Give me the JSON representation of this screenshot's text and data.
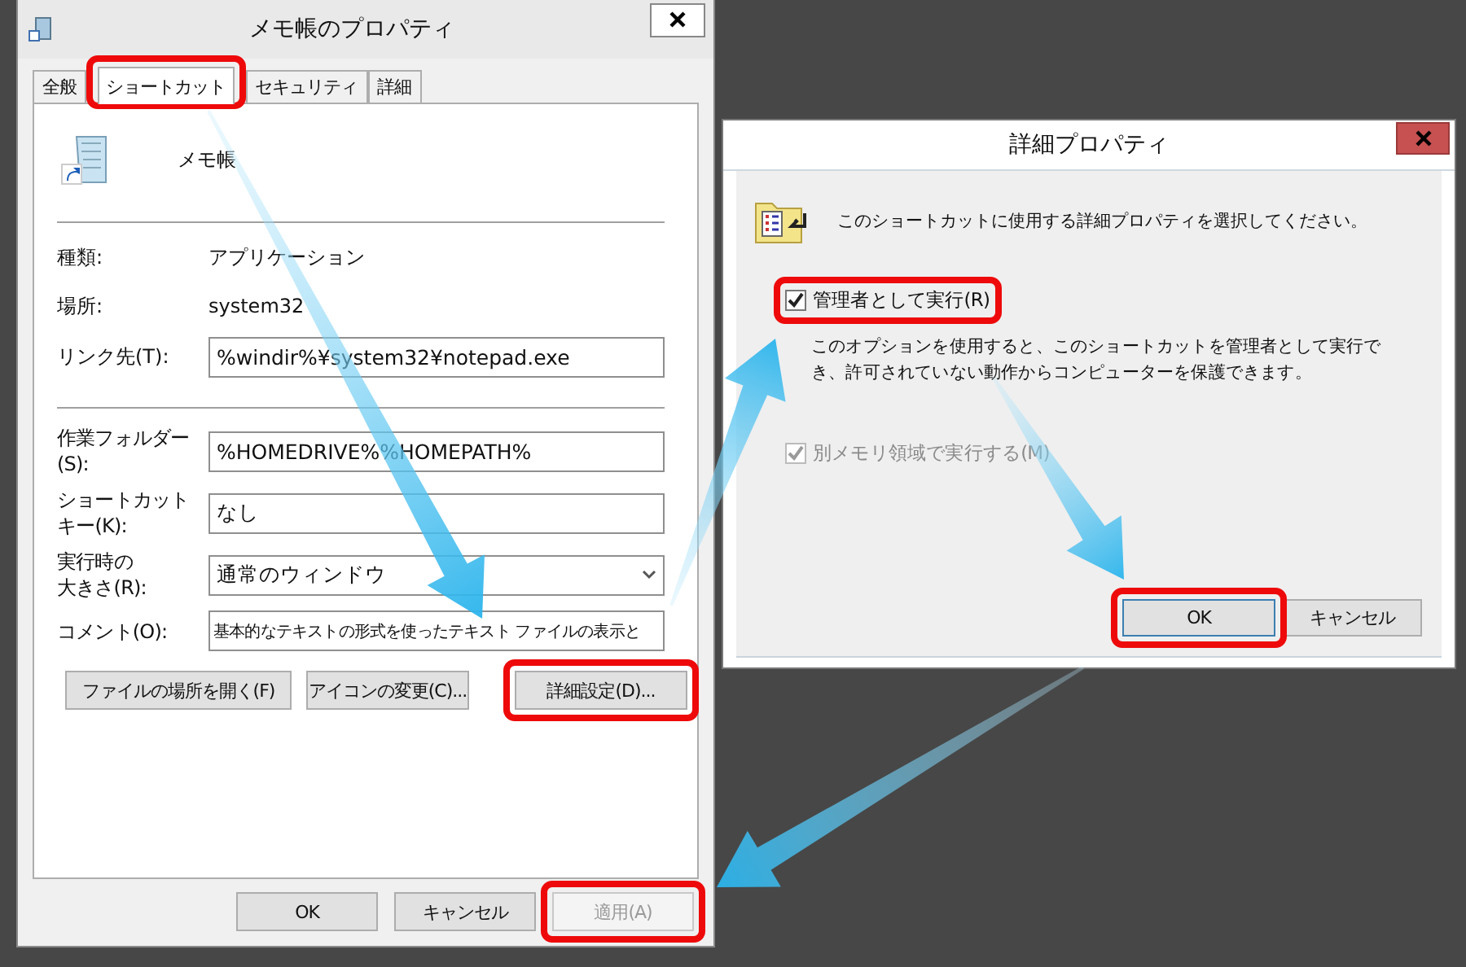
{
  "properties_dialog": {
    "title": "メモ帳のプロパティ",
    "tabs": [
      {
        "label": "全般",
        "selected": false,
        "highlighted": false
      },
      {
        "label": "ショートカット",
        "selected": true,
        "highlighted": true
      },
      {
        "label": "セキュリティ",
        "selected": false,
        "highlighted": false
      },
      {
        "label": "詳細",
        "selected": false,
        "highlighted": false
      }
    ],
    "app_name": "メモ帳",
    "info": [
      {
        "label": "種類:",
        "value": "アプリケーション"
      },
      {
        "label": "場所:",
        "value": "system32"
      }
    ],
    "target": {
      "label": "リンク先(T):",
      "value": "%windir%¥system32¥notepad.exe"
    },
    "fields": [
      {
        "kind": "text",
        "label_lines": [
          "作業フォルダー",
          "(S):"
        ],
        "value": "%HOMEDRIVE%%HOMEPATH%"
      },
      {
        "kind": "text",
        "label_lines": [
          "ショートカット",
          "キー(K):"
        ],
        "value": "なし"
      },
      {
        "kind": "select",
        "label_lines": [
          "実行時の",
          "大きさ(R):"
        ],
        "value": "通常のウィンドウ"
      },
      {
        "kind": "comment",
        "label_lines": [
          "コメント(O):"
        ],
        "value": "基本的なテキストの形式を使ったテキスト ファイルの表示と"
      }
    ],
    "buttons": [
      {
        "label": "ファイルの場所を開く(F)",
        "highlighted": false
      },
      {
        "label": "アイコンの変更(C)...",
        "highlighted": false
      },
      {
        "label": "詳細設定(D)...",
        "highlighted": true
      }
    ],
    "footer_buttons": [
      {
        "label": "OK",
        "disabled": false,
        "highlighted": false
      },
      {
        "label": "キャンセル",
        "disabled": false,
        "highlighted": false
      },
      {
        "label": "適用(A)",
        "disabled": true,
        "highlighted": true
      }
    ]
  },
  "advanced_dialog": {
    "title": "詳細プロパティ",
    "prompt": "このショートカットに使用する詳細プロパティを選択してください。",
    "options": [
      {
        "label": "管理者として実行(R)",
        "checked": true,
        "disabled": false,
        "highlighted": true,
        "description": "このオプションを使用すると、このショートカットを管理者として実行でき、許可されていない動作からコンピューターを保護できます。"
      },
      {
        "label": "別メモリ領域で実行する(M)",
        "checked": true,
        "disabled": true,
        "highlighted": false
      }
    ],
    "buttons": [
      {
        "label": "OK",
        "default": true,
        "highlighted": true
      },
      {
        "label": "キャンセル",
        "default": false,
        "highlighted": false
      }
    ]
  }
}
